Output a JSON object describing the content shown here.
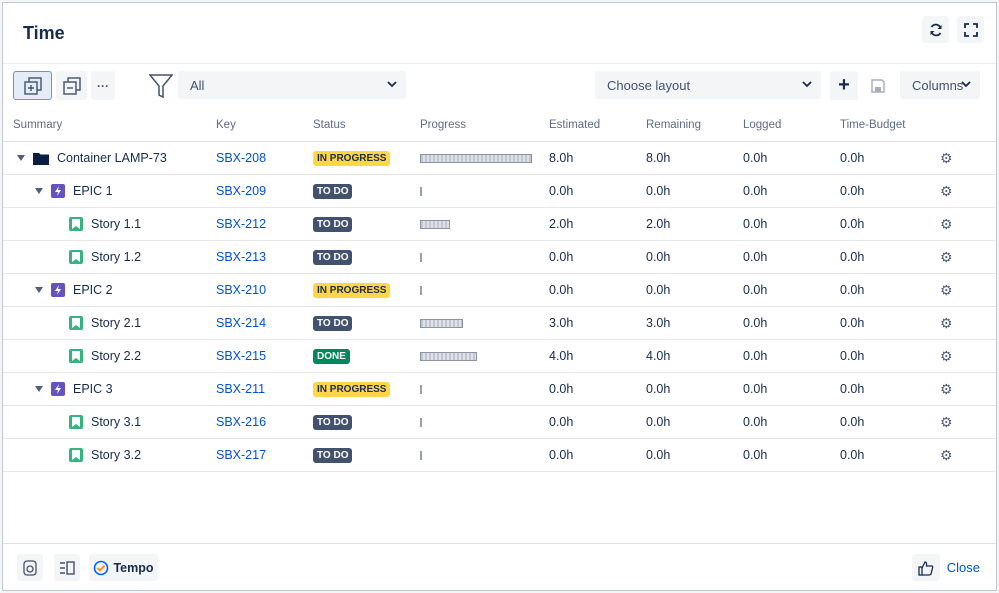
{
  "dialog": {
    "title": "Time"
  },
  "header": {
    "refresh_icon": "refresh-icon",
    "fullscreen_icon": "fullscreen-icon"
  },
  "toolbar": {
    "expand_icon": "expand-all-icon",
    "collapse_icon": "collapse-all-icon",
    "more_label": "···",
    "filter_icon": "filter-icon",
    "filter_value": "All",
    "layout_placeholder": "Choose layout",
    "add_label": "+",
    "save_icon": "save-icon",
    "columns_label": "Columns"
  },
  "table": {
    "headers": [
      "Summary",
      "Key",
      "Status",
      "Progress",
      "Estimated",
      "Remaining",
      "Logged",
      "Time-Budget"
    ],
    "rows": [
      {
        "summary": "Container LAMP-73",
        "level": 0,
        "type": "container",
        "expanded": true,
        "key": "SBX-208",
        "status": "IN PROGRESS",
        "progress": 1.0,
        "estimated": "8.0h",
        "remaining": "8.0h",
        "logged": "0.0h",
        "budget": "0.0h"
      },
      {
        "summary": "EPIC 1",
        "level": 1,
        "type": "epic",
        "expanded": true,
        "key": "SBX-209",
        "status": "TO DO",
        "progress": 0,
        "estimated": "0.0h",
        "remaining": "0.0h",
        "logged": "0.0h",
        "budget": "0.0h"
      },
      {
        "summary": "Story 1.1",
        "level": 2,
        "type": "story",
        "key": "SBX-212",
        "status": "TO DO",
        "progress": 0.25,
        "estimated": "2.0h",
        "remaining": "2.0h",
        "logged": "0.0h",
        "budget": "0.0h"
      },
      {
        "summary": "Story 1.2",
        "level": 2,
        "type": "story",
        "key": "SBX-213",
        "status": "TO DO",
        "progress": 0,
        "estimated": "0.0h",
        "remaining": "0.0h",
        "logged": "0.0h",
        "budget": "0.0h"
      },
      {
        "summary": "EPIC 2",
        "level": 1,
        "type": "epic",
        "expanded": true,
        "key": "SBX-210",
        "status": "IN PROGRESS",
        "progress": 0,
        "estimated": "0.0h",
        "remaining": "0.0h",
        "logged": "0.0h",
        "budget": "0.0h"
      },
      {
        "summary": "Story 2.1",
        "level": 2,
        "type": "story",
        "key": "SBX-214",
        "status": "TO DO",
        "progress": 0.375,
        "estimated": "3.0h",
        "remaining": "3.0h",
        "logged": "0.0h",
        "budget": "0.0h"
      },
      {
        "summary": "Story 2.2",
        "level": 2,
        "type": "story",
        "key": "SBX-215",
        "status": "DONE",
        "progress": 0.5,
        "estimated": "4.0h",
        "remaining": "4.0h",
        "logged": "0.0h",
        "budget": "0.0h"
      },
      {
        "summary": "EPIC 3",
        "level": 1,
        "type": "epic",
        "expanded": true,
        "key": "SBX-211",
        "status": "IN PROGRESS",
        "progress": 0,
        "estimated": "0.0h",
        "remaining": "0.0h",
        "logged": "0.0h",
        "budget": "0.0h"
      },
      {
        "summary": "Story 3.1",
        "level": 2,
        "type": "story",
        "key": "SBX-216",
        "status": "TO DO",
        "progress": 0,
        "estimated": "0.0h",
        "remaining": "0.0h",
        "logged": "0.0h",
        "budget": "0.0h"
      },
      {
        "summary": "Story 3.2",
        "level": 2,
        "type": "story",
        "key": "SBX-217",
        "status": "TO DO",
        "progress": 0,
        "estimated": "0.0h",
        "remaining": "0.0h",
        "logged": "0.0h",
        "budget": "0.0h"
      }
    ]
  },
  "footer": {
    "tempo_label": "Tempo",
    "close_label": "Close",
    "like_icon": "thumbs-up-icon"
  },
  "colors": {
    "accent": "#0052cc",
    "todo": "#42526e",
    "inprogress": "#ffd645",
    "done": "#00875a",
    "epic": "#6554c0",
    "story": "#36b37e"
  }
}
